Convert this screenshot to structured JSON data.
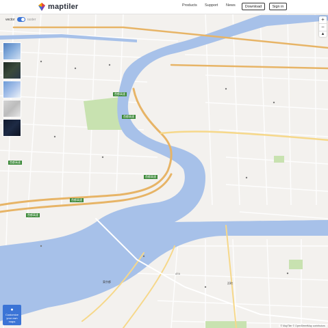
{
  "header": {
    "logo_text": "maptiler",
    "nav": [
      "Products",
      "Support",
      "News"
    ],
    "download_label": "Download",
    "signin_label": "Sign in"
  },
  "map_controls": {
    "vector_label": "vector",
    "raster_label": "raster",
    "zoom_in": "+",
    "zoom_out": "−",
    "compass": "▲"
  },
  "styles_panel": {
    "customize_icon": "palette-icon",
    "customize_label": "Customize your own maps"
  },
  "attribution": "© MapTiler © OpenStreetMap contributors",
  "colors": {
    "water": "#a7c1e9",
    "motorway": "#e7b466",
    "park": "#c5e1ac",
    "accent": "#3b74d6"
  },
  "map_labels": {
    "road_a": "首都高速",
    "road_b": "首都高速",
    "road_c": "首都高速",
    "road_d": "首都高速",
    "road_e": "首都高速",
    "road_f": "首都高速",
    "route_474": "474",
    "place_1": "浜町",
    "place_2": "東京都"
  }
}
